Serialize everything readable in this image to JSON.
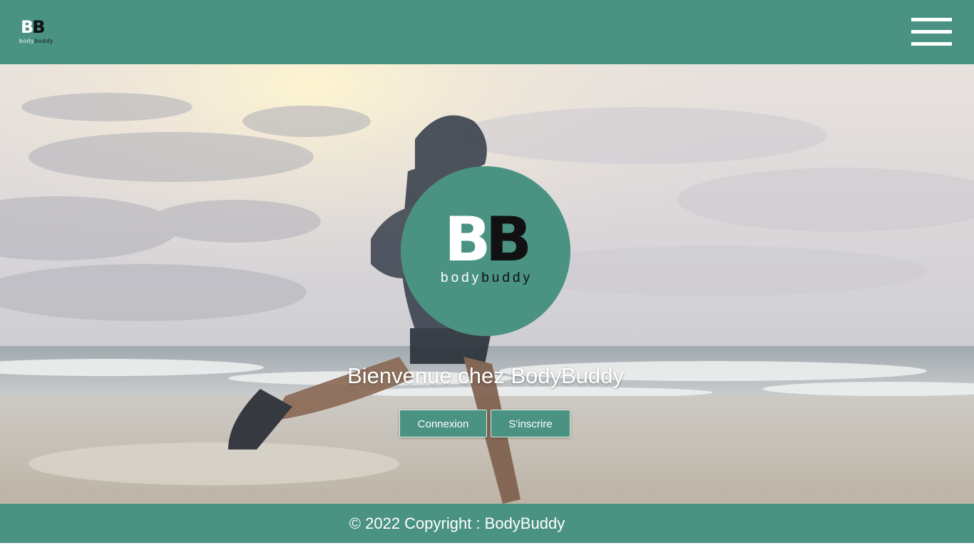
{
  "header": {
    "logo": {
      "letter_1": "B",
      "letter_2": "B",
      "word_1": "body",
      "word_2": "buddy"
    },
    "menu_icon": "hamburger-menu-icon"
  },
  "hero": {
    "background": "runner-on-beach-photo",
    "logo": {
      "letter_1": "B",
      "letter_2": "B",
      "word_1": "body",
      "word_2": "buddy"
    },
    "welcome_text": "Bienvenue chez BodyBuddy",
    "login_label": "Connexion",
    "signup_label": "S'inscrire"
  },
  "footer": {
    "copyright": "© 2022 Copyright : BodyBuddy"
  },
  "colors": {
    "brand_green": "#4a9282",
    "text_light": "#ffffff",
    "logo_dark": "#111111"
  }
}
